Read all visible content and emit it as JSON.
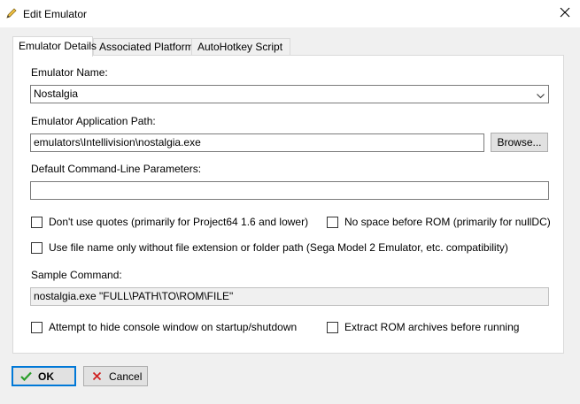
{
  "window": {
    "title": "Edit Emulator",
    "title_icon": "pencil-icon",
    "close_icon": "close-icon"
  },
  "tabs": [
    {
      "label": "Emulator Details",
      "active": true
    },
    {
      "label": "Associated Platforms",
      "active": false
    },
    {
      "label": "AutoHotkey Script",
      "active": false
    }
  ],
  "form": {
    "emulator_name_label": "Emulator Name:",
    "emulator_name_value": "Nostalgia",
    "application_path_label": "Emulator Application Path:",
    "application_path_value": "emulators\\Intellivision\\nostalgia.exe",
    "browse_label": "Browse...",
    "command_line_label": "Default Command-Line Parameters:",
    "command_line_value": "",
    "sample_command_label": "Sample Command:",
    "sample_command_value": "nostalgia.exe \"FULL\\PATH\\TO\\ROM\\FILE\""
  },
  "checkboxes": {
    "no_quotes": {
      "label": "Don't use quotes (primarily for Project64 1.6 and lower)",
      "checked": false
    },
    "no_space_before_rom": {
      "label": "No space before ROM (primarily for nullDC)",
      "checked": false
    },
    "file_name_only": {
      "label": "Use file name only without file extension or folder path (Sega Model 2 Emulator, etc. compatibility)",
      "checked": false
    },
    "hide_console": {
      "label": "Attempt to hide console window on startup/shutdown",
      "checked": false
    },
    "extract_rom": {
      "label": "Extract ROM archives before running",
      "checked": false
    }
  },
  "buttons": {
    "ok_label": "OK",
    "cancel_label": "Cancel"
  },
  "colors": {
    "ok_check": "#2a9d2a",
    "cancel_x": "#d02020",
    "default_button_border": "#0078d7"
  }
}
